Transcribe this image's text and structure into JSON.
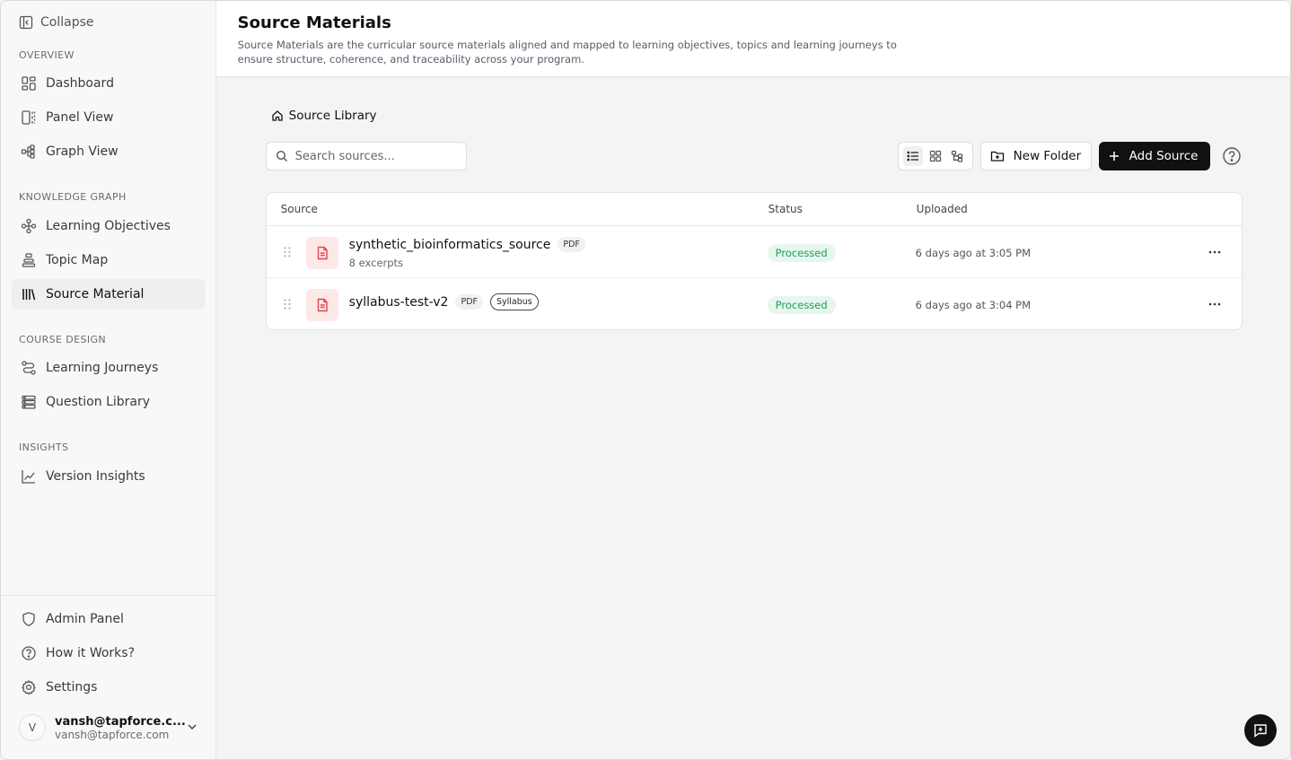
{
  "sidebar": {
    "collapse_label": "Collapse",
    "sections": {
      "overview": "OVERVIEW",
      "knowledge_graph": "KNOWLEDGE GRAPH",
      "course_design": "COURSE DESIGN",
      "insights": "INSIGHTS"
    },
    "items": {
      "dashboard": "Dashboard",
      "panel_view": "Panel View",
      "graph_view": "Graph View",
      "learning_objectives": "Learning Objectives",
      "topic_map": "Topic Map",
      "source_material": "Source Material",
      "learning_journeys": "Learning Journeys",
      "question_library": "Question Library",
      "version_insights": "Version Insights",
      "admin_panel": "Admin Panel",
      "how_it_works": "How it Works?",
      "settings": "Settings"
    },
    "active_item": "source_material",
    "user": {
      "initial": "V",
      "name": "vansh@tapforce.c...",
      "email": "vansh@tapforce.com"
    }
  },
  "header": {
    "title": "Source Materials",
    "description": "Source Materials are the curricular source materials aligned and mapped to learning objectives, topics and learning journeys to ensure structure, coherence, and traceability across your program."
  },
  "breadcrumb": {
    "label": "Source Library"
  },
  "toolbar": {
    "search_placeholder": "Search sources...",
    "new_folder_label": "New Folder",
    "add_source_label": "Add Source"
  },
  "table": {
    "columns": {
      "source": "Source",
      "status": "Status",
      "uploaded": "Uploaded"
    },
    "rows": [
      {
        "name": "synthetic_bioinformatics_source",
        "type": "PDF",
        "excerpts": "8 excerpts",
        "status": "Processed",
        "uploaded": "6 days ago at 3:05 PM"
      },
      {
        "name": "syllabus-test-v2",
        "type": "PDF",
        "tag": "Syllabus",
        "status": "Processed",
        "uploaded": "6 days ago at 3:04 PM"
      }
    ]
  },
  "colors": {
    "accent_dark": "#111111",
    "status_green": "#1e9e5d",
    "status_green_bg": "#e7f6ee",
    "file_icon_red": "#e0464e",
    "file_icon_bg": "#fde8e8"
  }
}
